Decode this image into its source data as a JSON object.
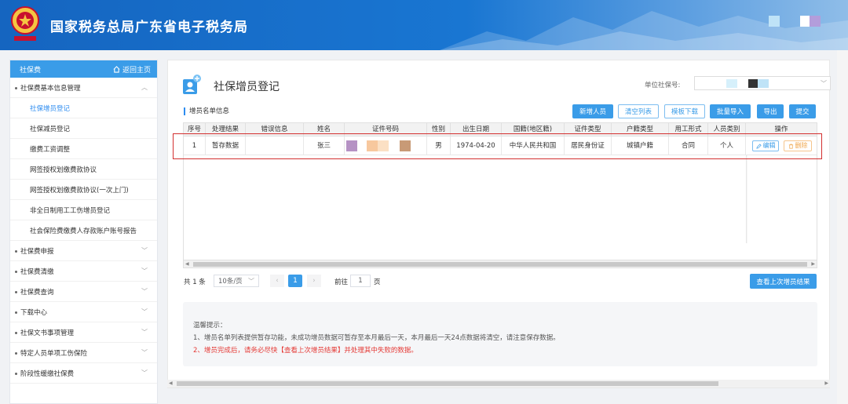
{
  "header": {
    "site_title": "国家税务总局广东省电子税务局",
    "colors": {
      "primary": "#1976d2",
      "accent": "#3a9ce8"
    }
  },
  "sidebar": {
    "section_title": "社保费",
    "home_link": "返回主页",
    "groups": [
      {
        "label": "社保费基本信息管理",
        "expanded": true,
        "items": [
          {
            "label": "社保增员登记",
            "active": true
          },
          {
            "label": "社保减员登记",
            "active": false
          },
          {
            "label": "缴费工资调整",
            "active": false
          },
          {
            "label": "网签授权划缴费款协议",
            "active": false
          },
          {
            "label": "网签授权划缴费款协议(一次上门)",
            "active": false
          },
          {
            "label": "非全日制用工工伤增员登记",
            "active": false
          },
          {
            "label": "社会保险费缴费人存款账户账号报告",
            "active": false
          }
        ]
      },
      {
        "label": "社保费申报",
        "expanded": false
      },
      {
        "label": "社保费清缴",
        "expanded": false
      },
      {
        "label": "社保费查询",
        "expanded": false
      },
      {
        "label": "下载中心",
        "expanded": false
      },
      {
        "label": "社保文书事项管理",
        "expanded": false
      },
      {
        "label": "特定人员单项工伤保险",
        "expanded": false
      },
      {
        "label": "阶段性缓缴社保费",
        "expanded": false
      }
    ]
  },
  "main": {
    "page_title": "社保增员登记",
    "unit_label": "单位社保号:",
    "section_title": "增员名单信息",
    "buttons": {
      "add": "新增人员",
      "clear": "清空列表",
      "template": "模板下载",
      "import": "批量导入",
      "export": "导出",
      "submit": "提交"
    },
    "table": {
      "headers": [
        "序号",
        "处理结果",
        "错误信息",
        "姓名",
        "证件号码",
        "性别",
        "出生日期",
        "国籍(地区籍)",
        "证件类型",
        "户籍类型",
        "用工形式",
        "人员类别",
        "操作"
      ],
      "rows": [
        {
          "index": "1",
          "result": "暂存数据",
          "error": "",
          "name": "张三",
          "id_number": "",
          "gender": "男",
          "birth": "1974-04-20",
          "nationality": "中华人民共和国",
          "id_type": "居民身份证",
          "household": "城镇户籍",
          "employment": "合同",
          "category": "个人",
          "edit": "编辑",
          "delete": "删除"
        }
      ]
    },
    "pagination": {
      "total": "共 1 条",
      "page_size": "10条/页",
      "current_page": "1",
      "goto_prefix": "前往",
      "goto_value": "1",
      "goto_suffix": "页"
    },
    "result_button": "查看上次增员结果",
    "tips": {
      "title": "温馨提示：",
      "line1": "1、增员名单列表提供暂存功能，未成功增员数据可暂存至本月最后一天，本月最后一天24点数据将清空，请注意保存数据。",
      "line2": "2、增员完成后，请务必尽快【查看上次增员结果】并处理其中失败的数据。"
    }
  }
}
